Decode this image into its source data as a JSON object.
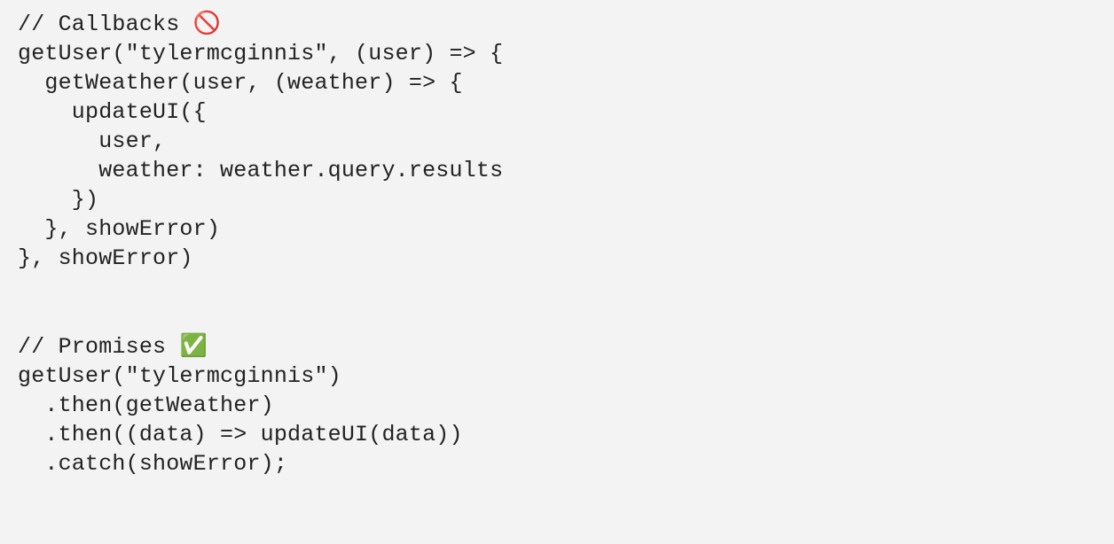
{
  "code": {
    "lines": [
      {
        "text": "// Callbacks ",
        "emoji": "🚫"
      },
      {
        "text": "getUser(\"tylermcginnis\", (user) => {"
      },
      {
        "text": "  getWeather(user, (weather) => {"
      },
      {
        "text": "    updateUI({"
      },
      {
        "text": "      user,"
      },
      {
        "text": "      weather: weather.query.results"
      },
      {
        "text": "    })"
      },
      {
        "text": "  }, showError)"
      },
      {
        "text": "}, showError)"
      },
      {
        "text": ""
      },
      {
        "text": ""
      },
      {
        "text": "// Promises ",
        "emoji": "✅"
      },
      {
        "text": "getUser(\"tylermcginnis\")"
      },
      {
        "text": "  .then(getWeather)"
      },
      {
        "text": "  .then((data) => updateUI(data))"
      },
      {
        "text": "  .catch(showError);"
      }
    ]
  }
}
